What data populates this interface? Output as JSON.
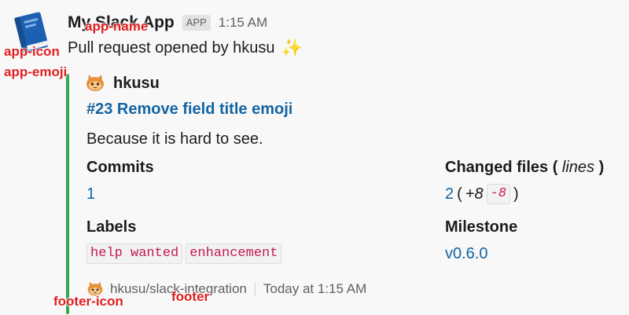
{
  "message": {
    "app_name": "My Slack App",
    "app_badge": "APP",
    "timestamp": "1:15 AM",
    "pretext": "Pull request opened by hkusu",
    "pretext_emoji": "✨"
  },
  "attachment": {
    "color": "#36a64f",
    "author_name": "hkusu",
    "title": "#23 Remove field title emoji",
    "text": "Because it is hard to see.",
    "fields": {
      "commits": {
        "title": "Commits",
        "value": "1"
      },
      "changed_files": {
        "title_prefix": "Changed files (",
        "title_emphasis": "lines",
        "title_suffix": ")",
        "value": "2",
        "open_paren": "(",
        "additions": "+8",
        "deletions": "-8",
        "close_paren": ")"
      },
      "labels": {
        "title": "Labels",
        "values": [
          "help wanted",
          "enhancement"
        ]
      },
      "milestone": {
        "title": "Milestone",
        "value": "v0.6.0"
      }
    },
    "footer": {
      "text": "hkusu/slack-integration",
      "timestamp": "Today at 1:15 AM"
    }
  },
  "annotations": {
    "app_name": "app-name",
    "app_icon": "app-icon",
    "app_emoji": "app-emoji",
    "footer_icon": "footer-icon",
    "footer": "footer"
  },
  "colors": {
    "link": "#1264a3",
    "attachment_bar": "#36a64f",
    "annotation": "#e01e1e",
    "code": "#c61a4e"
  },
  "icons": {
    "app_icon": "book-icon",
    "author_icon": "octocat-icon",
    "footer_icon": "octocat-icon",
    "pretext_emoji": "sparkles-icon"
  }
}
